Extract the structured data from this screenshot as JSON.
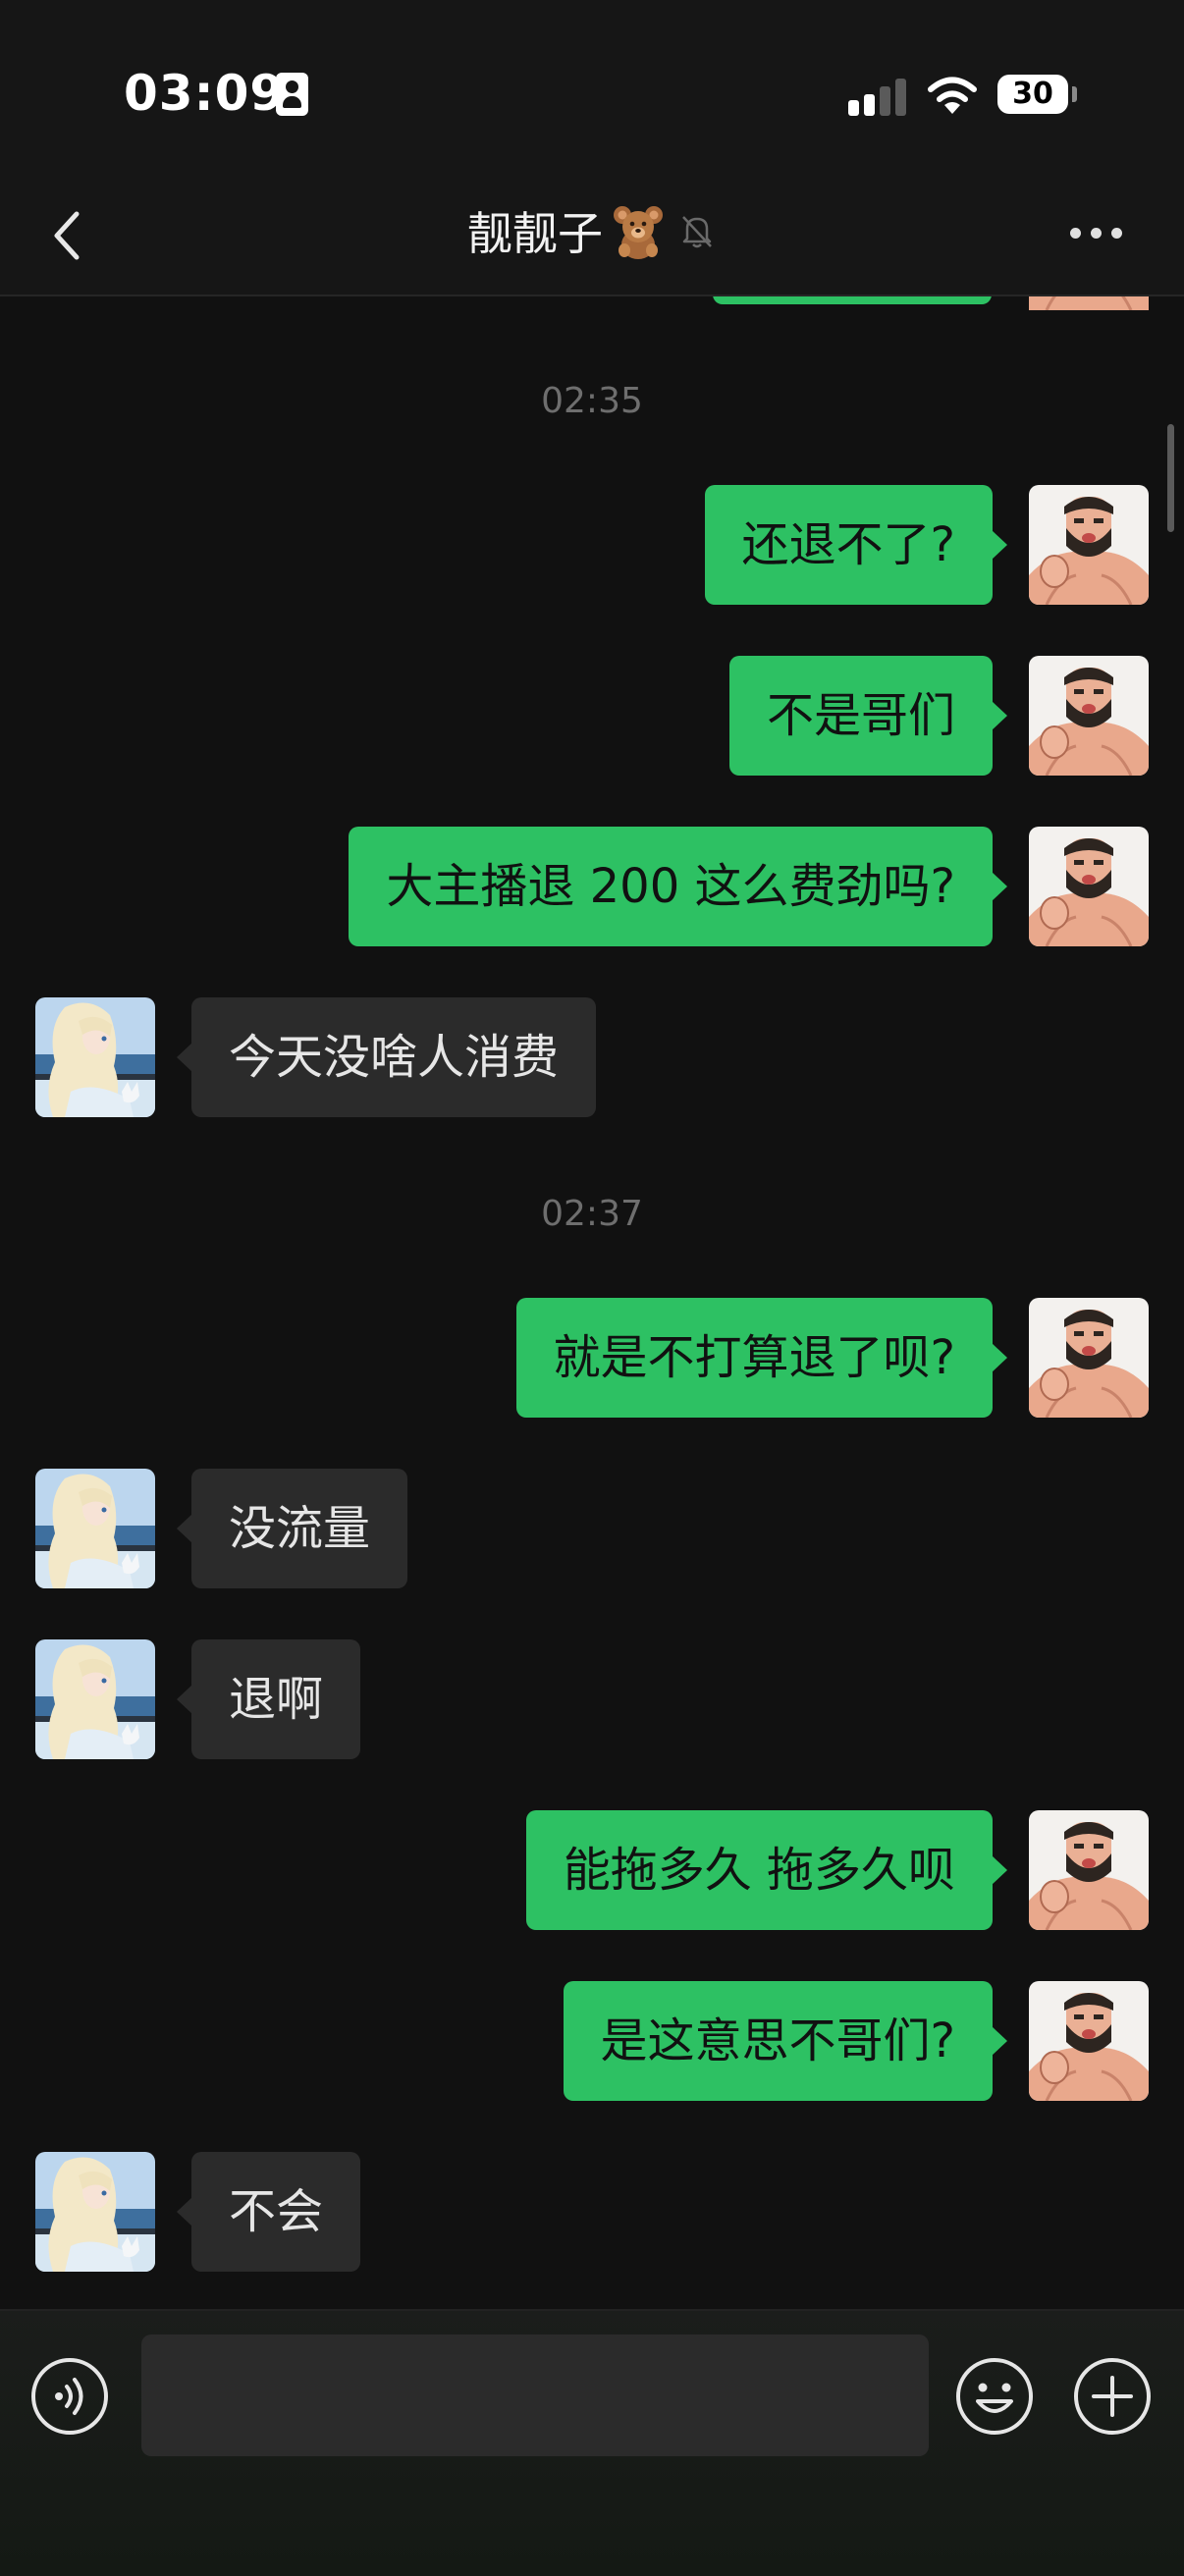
{
  "status_bar": {
    "time": "03:09",
    "battery_percent": "30",
    "signal_bars_active": 2,
    "signal_bars_total": 4
  },
  "nav": {
    "title": "靓靓子",
    "title_emoji_icon": "teddy-bear-icon",
    "muted": true,
    "back_icon": "chevron-left-icon",
    "more_icon": "more-dots-icon"
  },
  "colors": {
    "background": "#111111",
    "outgoing_bubble": "#2dc163",
    "incoming_bubble": "#2b2b2b",
    "timestamp_text": "#6e6e6e"
  },
  "chat": {
    "timestamps": [
      "02:35",
      "02:37"
    ],
    "messages": [
      {
        "direction": "out",
        "text": "还退不了?"
      },
      {
        "direction": "out",
        "text": "不是哥们"
      },
      {
        "direction": "out",
        "text": "大主播退 200 这么费劲吗?"
      },
      {
        "direction": "in",
        "text": "今天没啥人消费"
      },
      {
        "direction": "out",
        "text": "就是不打算退了呗?"
      },
      {
        "direction": "in",
        "text": "没流量"
      },
      {
        "direction": "in",
        "text": "退啊"
      },
      {
        "direction": "out",
        "text": "能拖多久 拖多久呗"
      },
      {
        "direction": "out",
        "text": "是这意思不哥们?"
      },
      {
        "direction": "in",
        "text": "不会"
      }
    ]
  },
  "input_bar": {
    "voice_icon": "voice-icon",
    "text_value": "",
    "emoji_icon": "emoji-icon",
    "plus_icon": "plus-icon"
  }
}
